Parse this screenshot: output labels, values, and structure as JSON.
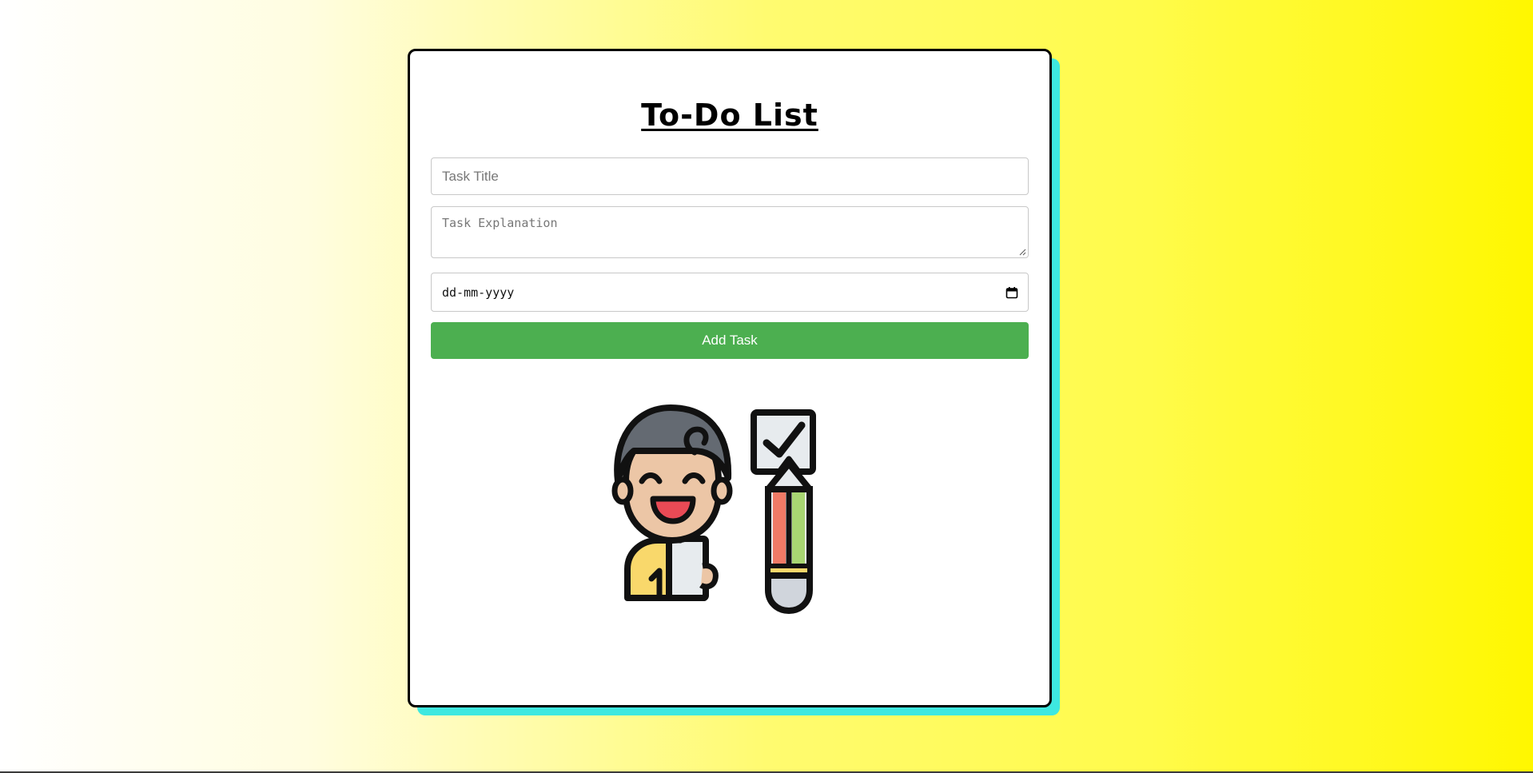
{
  "page": {
    "title": "To-Do List"
  },
  "form": {
    "task_title_placeholder": "Task Title",
    "task_title_value": "",
    "task_explanation_placeholder": "Task Explanation",
    "task_explanation_value": "",
    "date_placeholder": "dd-mm-yyyy",
    "add_button_label": "Add Task"
  },
  "illustration": {
    "icon": "person-with-checklist-and-pencil"
  },
  "colors": {
    "button": "#4caf50",
    "card_shadow": "#3ee8e0",
    "card_border": "#000000",
    "background_end": "#fff700"
  }
}
